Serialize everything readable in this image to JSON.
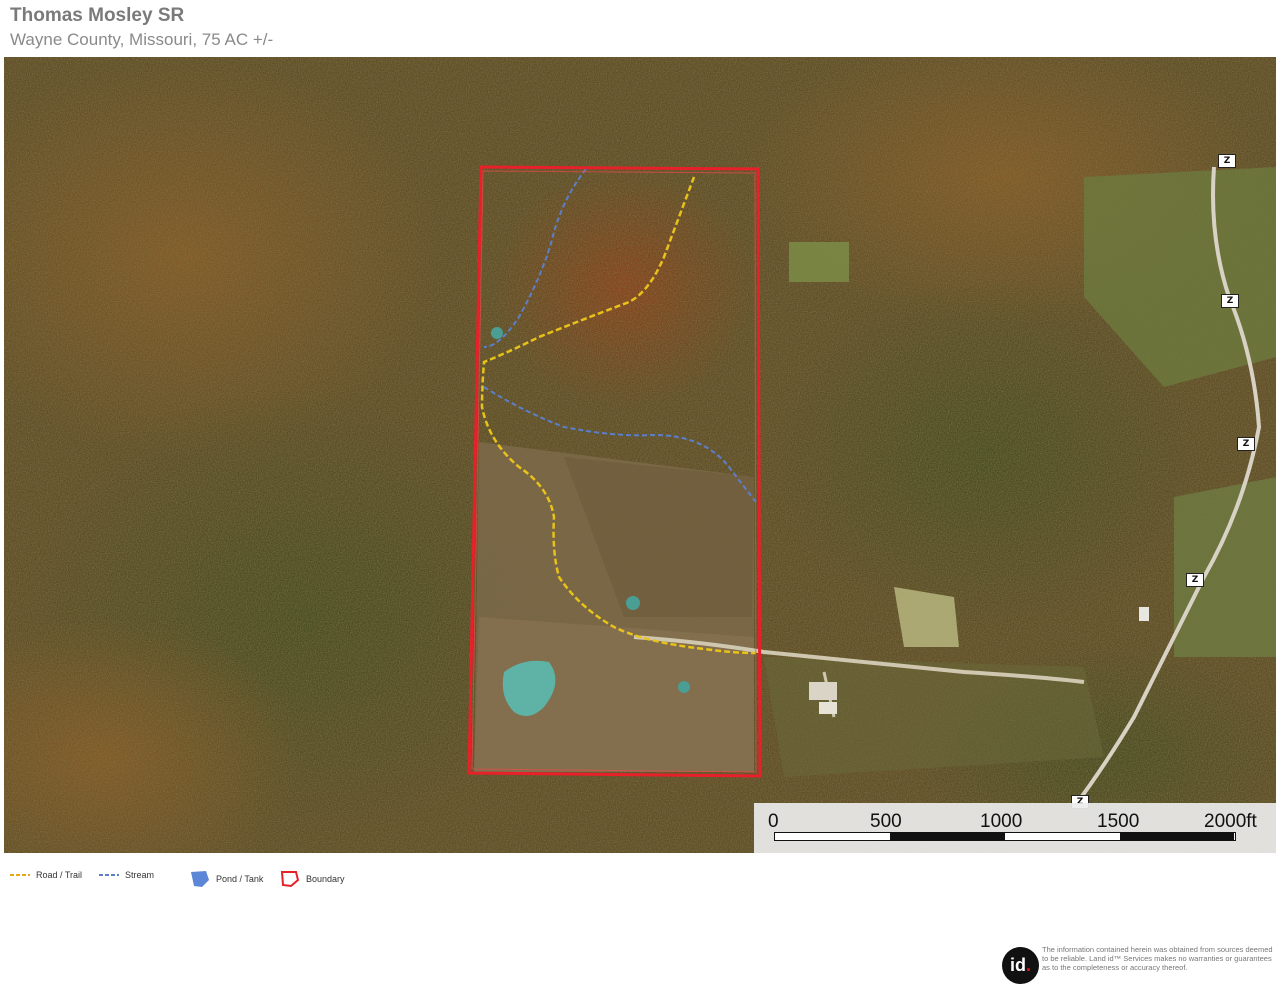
{
  "header": {
    "title": "Thomas Mosley SR",
    "subtitle": "Wayne County, Missouri, 75 AC +/-"
  },
  "map": {
    "highway_label": "Z",
    "colors": {
      "forest": "#5b4a24",
      "boundary": "#e8202a",
      "road_trail": "#e8c21a",
      "stream": "#5b7fc9",
      "pond": "#4fa6a0"
    }
  },
  "scale_bar": {
    "labels": [
      "0",
      "500",
      "1000",
      "1500",
      "2000ft"
    ]
  },
  "legend": {
    "items": [
      {
        "label": "Road / Trail",
        "icon": "dashed-line-yellow"
      },
      {
        "label": "Stream",
        "icon": "dashed-line-blue"
      },
      {
        "label": "Pond / Tank",
        "icon": "blue-polygon"
      },
      {
        "label": "Boundary",
        "icon": "red-outline-polygon"
      }
    ]
  },
  "footer": {
    "logo_text": "id",
    "disclaimer": "The information contained herein was obtained from sources deemed to be reliable. Land id™ Services makes no warranties or guarantees as to the completeness or accuracy thereof."
  }
}
